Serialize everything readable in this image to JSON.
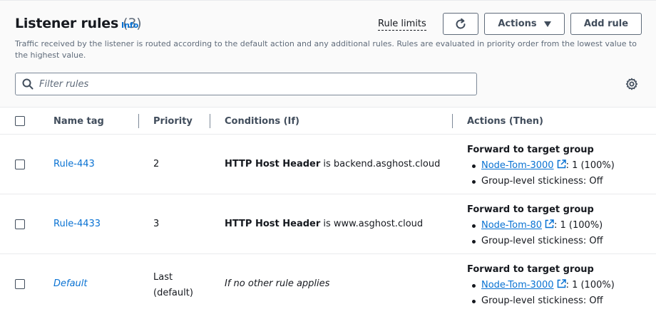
{
  "header": {
    "title": "Listener rules",
    "count": "(3)",
    "info_label": "Info",
    "rule_limits_label": "Rule limits",
    "actions_label": "Actions",
    "add_rule_label": "Add rule",
    "description": "Traffic received by the listener is routed according to the default action and any additional rules. Rules are evaluated in priority order from the lowest value to the highest value."
  },
  "filter": {
    "placeholder": "Filter rules",
    "value": ""
  },
  "table": {
    "columns": [
      "Name tag",
      "Priority",
      "Conditions (If)",
      "Actions (Then)"
    ],
    "rows": [
      {
        "name": "Rule-443",
        "priority": "2",
        "condition_key": "HTTP Host Header",
        "condition_rest": " is backend.asghost.cloud",
        "action_title": "Forward to target group",
        "target_group": "Node-Tom-3000",
        "weight": ": 1 (100%)",
        "stickiness": "Group-level stickiness: Off"
      },
      {
        "name": "Rule-4433",
        "priority": "3",
        "condition_key": "HTTP Host Header",
        "condition_rest": " is www.asghost.cloud",
        "action_title": "Forward to target group",
        "target_group": "Node-Tom-80",
        "weight": ": 1 (100%)",
        "stickiness": "Group-level stickiness: Off"
      },
      {
        "name": "Default",
        "priority_line1": "Last",
        "priority_line2": "(default)",
        "condition": "If no other rule applies",
        "action_title": "Forward to target group",
        "target_group": "Node-Tom-3000",
        "weight": ": 1 (100%)",
        "stickiness": "Group-level stickiness: Off"
      }
    ]
  },
  "colors": {
    "link": "#0972d3",
    "text": "#16191f",
    "muted": "#5f6b7a",
    "border": "#e9ebed",
    "header_bg": "#fafafa"
  },
  "icons": {
    "refresh": "refresh-icon",
    "caret": "caret-down-icon",
    "search": "search-icon",
    "settings": "gear-icon",
    "external": "external-link-icon"
  }
}
